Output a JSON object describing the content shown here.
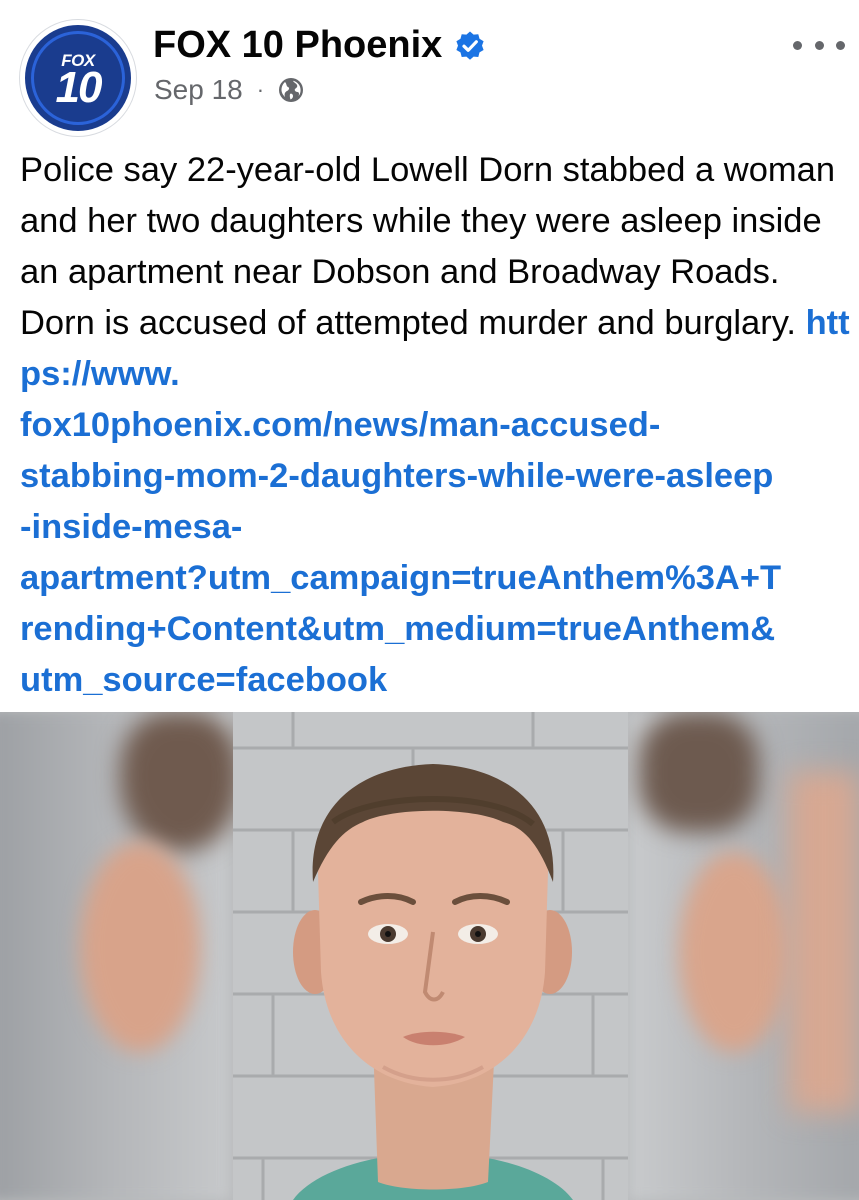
{
  "post": {
    "avatar": {
      "line1": "FOX",
      "line2": "10"
    },
    "page_name": "FOX 10 Phoenix",
    "verified_icon": "verified-badge-icon",
    "date": "Sep 18",
    "separator": "·",
    "audience_icon": "globe-icon",
    "more_icon": "more-options-icon",
    "text": "Police say 22-year-old Lowell Dorn stabbed a woman and her two daughters while they were asleep inside an apartment near Dobson and Broadway Roads. Dorn is accused of attempted murder and burglary. ",
    "link": "https://www.fox10phoenix.com/news/man-accused-stabbing-mom-2-daughters-while-were-asleep-inside-mesa-apartment?utm_campaign=trueAnthem%3A+Trending+Content&utm_medium=trueAnthem&utm_source=facebook",
    "link_display_lines": [
      "https://www.",
      "fox10phoenix.com/news/man-accused-",
      "stabbing-mom-2-daughters-while-were-asleep",
      "-inside-mesa-",
      "apartment?utm_campaign=trueAnthem%3A+T",
      "rending+Content&utm_medium=trueAnthem&",
      "utm_source=facebook"
    ]
  },
  "colors": {
    "link": "#1b6fd4",
    "verified": "#1b74e4",
    "avatar_bg": "#1a3c8e",
    "meta_text": "#65676b"
  }
}
